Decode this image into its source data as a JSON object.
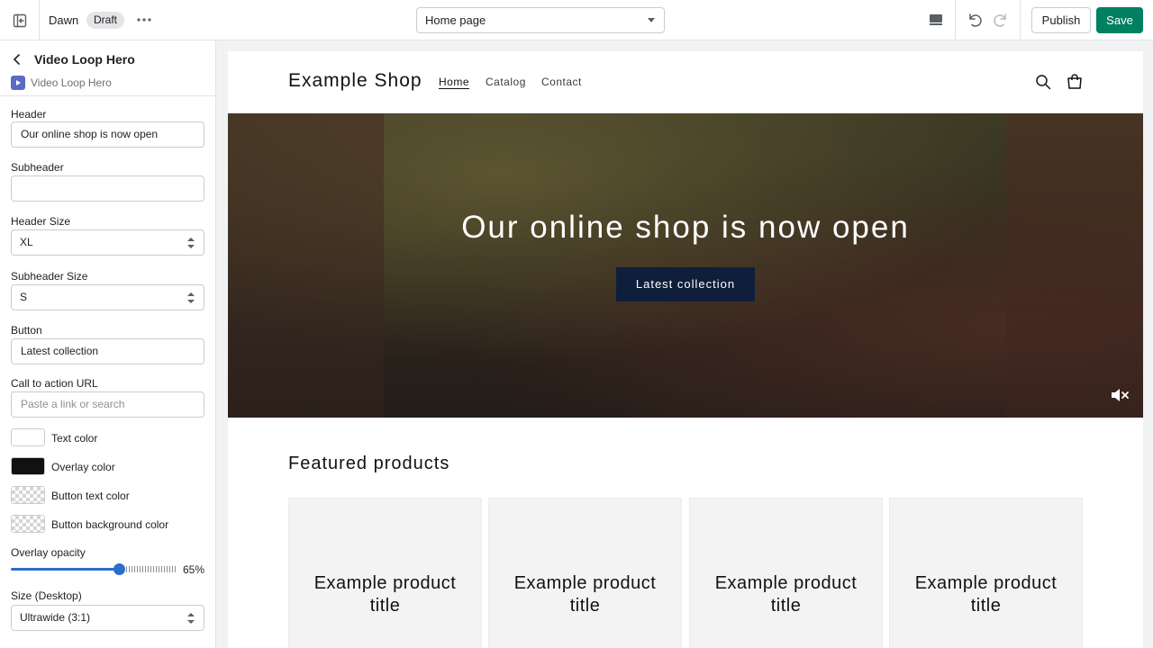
{
  "topbar": {
    "theme_name": "Dawn",
    "status_badge": "Draft",
    "page_selector": "Home page",
    "publish_label": "Publish",
    "save_label": "Save",
    "save_color": "#008060"
  },
  "sidebar": {
    "title": "Video Loop Hero",
    "subtitle": "Video Loop Hero",
    "fields": {
      "header_label": "Header",
      "header_value": "Our online shop is now open",
      "subheader_label": "Subheader",
      "subheader_value": "",
      "header_size_label": "Header Size",
      "header_size_value": "XL",
      "subheader_size_label": "Subheader Size",
      "subheader_size_value": "S",
      "button_label": "Button",
      "button_value": "Latest collection",
      "cta_label": "Call to action URL",
      "cta_placeholder": "Paste a link or search",
      "size_label": "Size (Desktop)",
      "size_value": "Ultrawide (3:1)"
    },
    "colors": [
      {
        "label": "Text color",
        "swatch": "#ffffff"
      },
      {
        "label": "Overlay color",
        "swatch": "#111111"
      },
      {
        "label": "Button text color",
        "swatch": "transparent"
      },
      {
        "label": "Button background color",
        "swatch": "transparent"
      }
    ],
    "opacity": {
      "label": "Overlay opacity",
      "value_text": "65%",
      "value": 0.65
    }
  },
  "preview": {
    "logo": "Example Shop",
    "nav": [
      "Home",
      "Catalog",
      "Contact"
    ],
    "hero": {
      "title": "Our online shop is now open",
      "button": "Latest collection",
      "button_color": "#0f1f3b"
    },
    "featured_title": "Featured products",
    "products": [
      {
        "title": "Example product title"
      },
      {
        "title": "Example product title"
      },
      {
        "title": "Example product title"
      },
      {
        "title": "Example product title"
      }
    ]
  }
}
